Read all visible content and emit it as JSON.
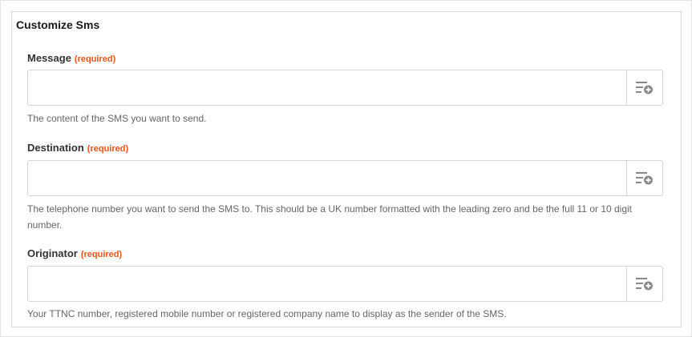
{
  "section": {
    "title": "Customize Sms"
  },
  "fields": [
    {
      "label": "Message",
      "required_text": "(required)",
      "value": "",
      "help": "The content of the SMS you want to send.",
      "action_icon": "insert-data-icon"
    },
    {
      "label": "Destination",
      "required_text": "(required)",
      "value": "",
      "help": "The telephone number you want to send the SMS to. This should be a UK number formatted with the leading zero and be the full 11 or 10 digit number.",
      "action_icon": "insert-data-icon"
    },
    {
      "label": "Originator",
      "required_text": "(required)",
      "value": "",
      "help": "Your TTNC number, registered mobile number or registered company name to display as the sender of the SMS.",
      "action_icon": "insert-data-icon"
    }
  ],
  "colors": {
    "required": "#e8541b",
    "border": "#d4d4d4",
    "help_text": "#666666"
  }
}
